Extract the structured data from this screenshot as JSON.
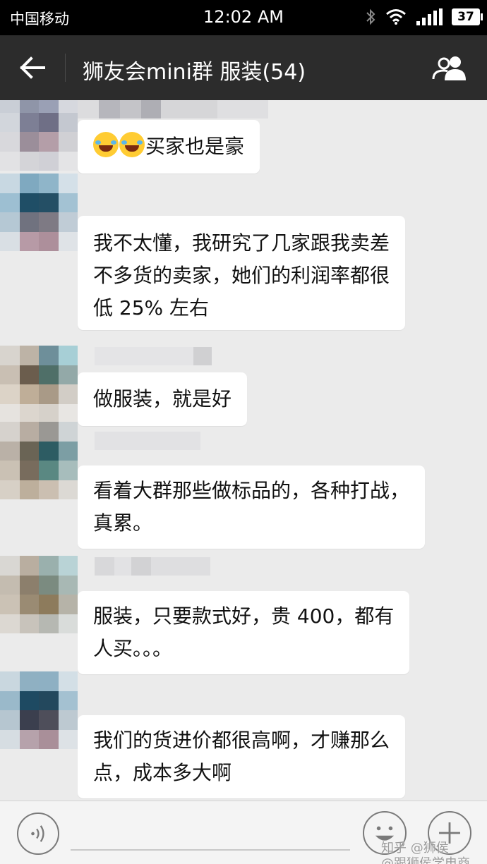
{
  "status_bar": {
    "carrier": "中国移动",
    "time": "12:02 AM",
    "battery": "37",
    "icons": [
      "bluetooth-icon",
      "wifi-icon",
      "signal-icon",
      "battery-icon"
    ]
  },
  "header": {
    "back_icon": "arrow-left-icon",
    "title": "狮友会mini群 服装(54)",
    "members_icon": "group-members-icon"
  },
  "messages": [
    {
      "emoji_count": 2,
      "emoji_name": "tears-of-joy-emoji",
      "lines": [
        "买家也是豪"
      ]
    },
    {
      "lines": [
        "我不太懂，我研究了几家跟我卖差",
        "不多货的卖家，她们的利润率都很",
        "低 25% 左右"
      ]
    },
    {
      "lines": [
        "做服装，就是好"
      ]
    },
    {
      "lines": [
        "看着大群那些做标品的，各种打战，",
        "真累。"
      ]
    },
    {
      "lines": [
        "服装，只要款式好，贵 400，都有",
        "人买。。。"
      ]
    },
    {
      "lines": [
        "我们的货进价都很高啊，才赚那么",
        "点，成本多大啊"
      ]
    }
  ],
  "input_bar": {
    "voice_icon": "voice-icon",
    "emoji_icon": "smiley-icon",
    "plus_icon": "plus-icon"
  },
  "watermark": {
    "line1": "知乎 @狮侯",
    "line2": "@跟狮侯学电商"
  },
  "colors": {
    "status_bar": "#000000",
    "title_bar": "#2c2c2c",
    "chat_background": "#ebebeb",
    "bubble": "#ffffff"
  }
}
